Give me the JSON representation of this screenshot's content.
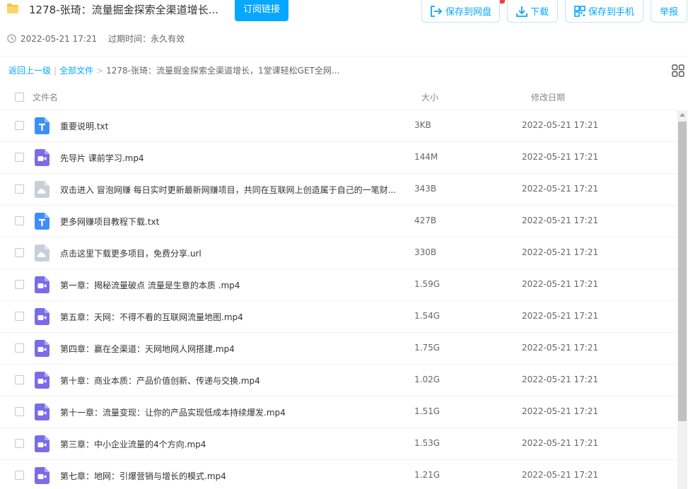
{
  "header": {
    "title": "1278-张琦：流量掘金探索全渠道增长...",
    "subscribe_label": "订阅链接",
    "timestamp": "2022-05-21 17:21",
    "expire": "过期时间：永久有效"
  },
  "toolbar": {
    "save_label": "保存到网盘",
    "download_label": "下载",
    "save_phone_label": "保存到手机",
    "report_label": "举报"
  },
  "breadcrumb": {
    "back": "返回上一级",
    "all_files": "全部文件",
    "current": "1278-张琦：流量掘金探索全渠道增长，1堂课轻松GET全网..."
  },
  "table": {
    "columns": [
      "文件名",
      "大小",
      "修改日期"
    ],
    "rows": [
      {
        "name": "重要说明.txt",
        "size": "3KB",
        "date": "2022-05-21 17:21",
        "icon": "text-file-icon"
      },
      {
        "name": "先导片 课前学习.mp4",
        "size": "144M",
        "date": "2022-05-21 17:21",
        "icon": "video-file-icon"
      },
      {
        "name": "双击进入 冒泡网赚 每日实时更新最新网赚项目，共同在互联网上创造属于自己的一笔财...",
        "size": "343B",
        "date": "2022-05-21 17:21",
        "icon": "link-file-icon"
      },
      {
        "name": "更多网赚项目教程下载.txt",
        "size": "427B",
        "date": "2022-05-21 17:21",
        "icon": "text-file-icon"
      },
      {
        "name": "点击这里下载更多项目，免费分享.url",
        "size": "330B",
        "date": "2022-05-21 17:21",
        "icon": "link-file-icon"
      },
      {
        "name": "第一章：揭秘流量破点 流量是生意的本质 .mp4",
        "size": "1.59G",
        "date": "2022-05-21 17:21",
        "icon": "video-file-icon"
      },
      {
        "name": "第五章：天网：不得不看的互联网流量地图.mp4",
        "size": "1.54G",
        "date": "2022-05-21 17:21",
        "icon": "video-file-icon"
      },
      {
        "name": "第四章：赢在全渠道：天网地网人网搭建.mp4",
        "size": "1.75G",
        "date": "2022-05-21 17:21",
        "icon": "video-file-icon"
      },
      {
        "name": "第十章：商业本质：产品价值创新、传递与交换.mp4",
        "size": "1.02G",
        "date": "2022-05-21 17:21",
        "icon": "video-file-icon"
      },
      {
        "name": "第十一章：流量变现：让你的产品实现低成本持续爆发.mp4",
        "size": "1.51G",
        "date": "2022-05-21 17:21",
        "icon": "video-file-icon"
      },
      {
        "name": "第三章：中小企业流量的4个方向.mp4",
        "size": "1.53G",
        "date": "2022-05-21 17:21",
        "icon": "video-file-icon"
      },
      {
        "name": "第七章：地网：引爆营销与增长的模式.mp4",
        "size": "1.21G",
        "date": "2022-05-21 17:21",
        "icon": "video-file-icon"
      }
    ]
  },
  "colors": {
    "accent": "#06a7ff",
    "text_file": "#3d8ff6",
    "video_file": "#7a6be8",
    "link_file": "#c7cfd8"
  }
}
